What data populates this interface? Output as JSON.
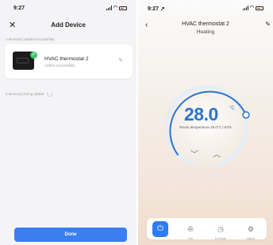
{
  "left_screen": {
    "status": {
      "time": "9:27"
    },
    "title": "Add Device",
    "added_label": "1 device(s) added successfully",
    "device": {
      "name": "HVAC thermostat  2",
      "status": "Added successfully"
    },
    "adding_label": "0 device(s) being added",
    "done_label": "Done",
    "colors": {
      "accent": "#3a7ef2",
      "success": "#3ec46d"
    }
  },
  "right_screen": {
    "status": {
      "time": "9:27"
    },
    "device_name": "HVAC thermostat  2",
    "mode": "Heating",
    "temperature": "28.0",
    "unit": "°C",
    "room_temperature": "Room temperature 28.0°C / 67%",
    "tabs": [
      {
        "label": "",
        "icon": "power-icon"
      },
      {
        "label": "Fan",
        "icon": "fan-icon"
      },
      {
        "label": "Schedule",
        "icon": "schedule-icon"
      },
      {
        "label": "setting",
        "icon": "gear-icon"
      }
    ],
    "colors": {
      "accent": "#2e74c8",
      "power_button": "#2e7cf3"
    }
  }
}
